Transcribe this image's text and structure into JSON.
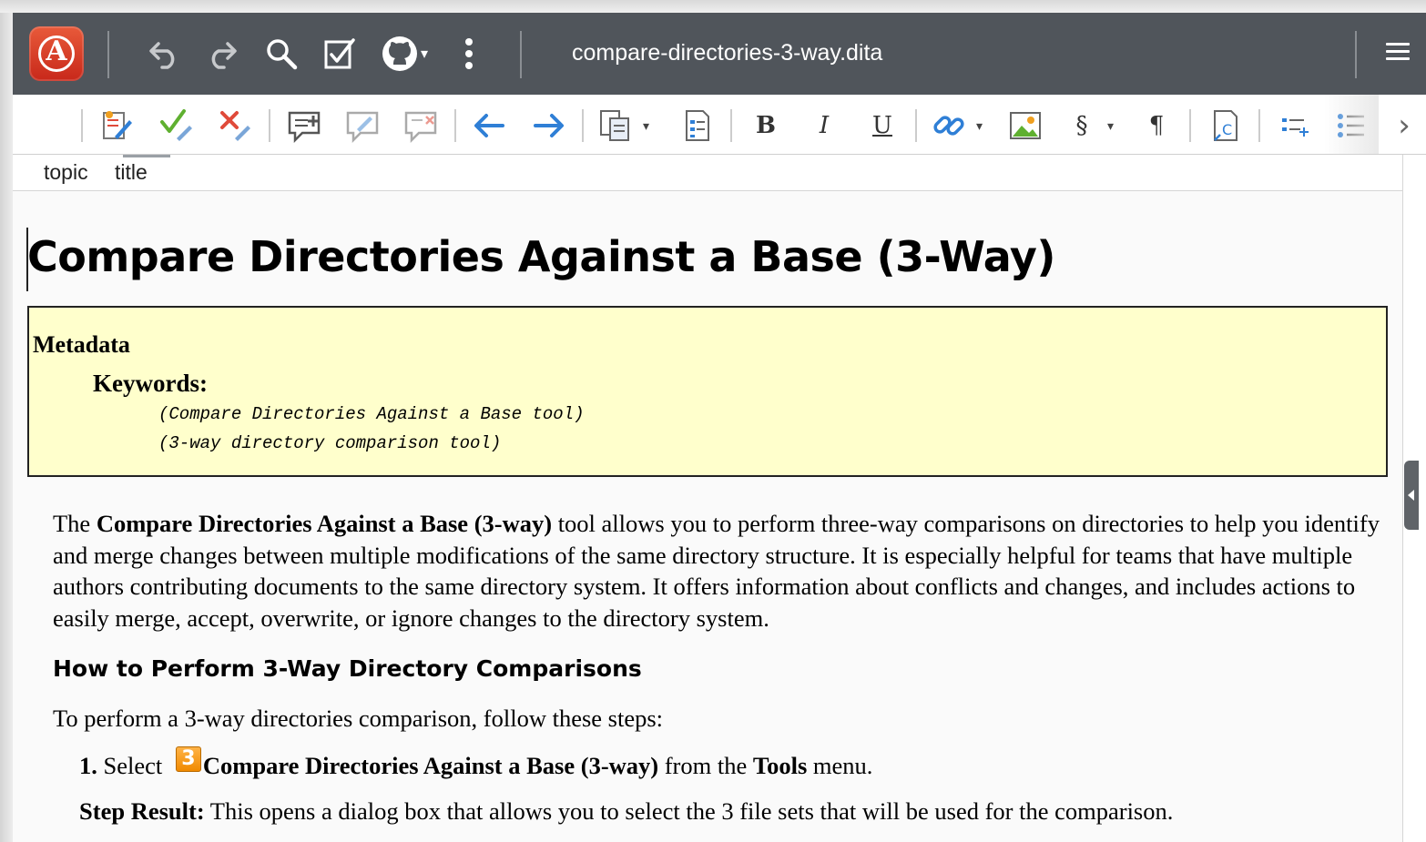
{
  "window": {
    "file_name": "compare-directories-3-way.dita"
  },
  "topbar": {
    "icons": [
      "app-logo-icon",
      "undo-icon",
      "redo-icon",
      "search-icon",
      "validate-icon",
      "github-icon",
      "more-vertical-icon",
      "hamburger-menu-icon"
    ],
    "app_logo_letter": "A",
    "github_caret": "▾"
  },
  "toolbar": {
    "bold_label": "B",
    "italic_label": "I",
    "underline_label": "U",
    "section_label": "§",
    "pilcrow_label": "¶",
    "caret": "▾",
    "next_label": "›"
  },
  "breadcrumb": {
    "items": [
      "topic",
      "title"
    ]
  },
  "document": {
    "title": "Compare Directories Against a Base (3-Way)",
    "metadata": {
      "heading": "Metadata",
      "keywords_label": "Keywords:",
      "keywords": [
        "(Compare Directories Against a Base tool)",
        "(3-way directory comparison tool)"
      ]
    },
    "intro": {
      "lead": "The ",
      "bold": "Compare Directories Against a Base (3-way)",
      "rest": " tool allows you to perform three-way comparisons on directories to help you identify and merge changes between multiple modifications of the same directory structure. It is especially helpful for teams that have multiple authors contributing documents to the same directory system. It offers information about conflicts and changes, and includes actions to easily merge, accept, overwrite, or ignore changes to the directory system."
    },
    "section_heading": "How to Perform 3-Way Directory Comparisons",
    "section_lead": "To perform a 3-way directories comparison, follow these steps:",
    "step1": {
      "number": "1.",
      "select": " Select ",
      "badge": "3",
      "tool": "Compare Directories Against a Base (3-way)",
      "from": " from the ",
      "menu": "Tools",
      "menu_suffix": " menu."
    },
    "step_result": {
      "label": "Step Result:",
      "text": " This opens a dialog box that allows you to select the 3 file sets that will be used for the comparison."
    }
  },
  "colors": {
    "topbar_bg": "#50555b",
    "metadata_bg": "#ffffcc",
    "arrow_blue": "#2f7fd6",
    "accept_green": "#5fb030",
    "reject_red": "#e04a3a"
  }
}
